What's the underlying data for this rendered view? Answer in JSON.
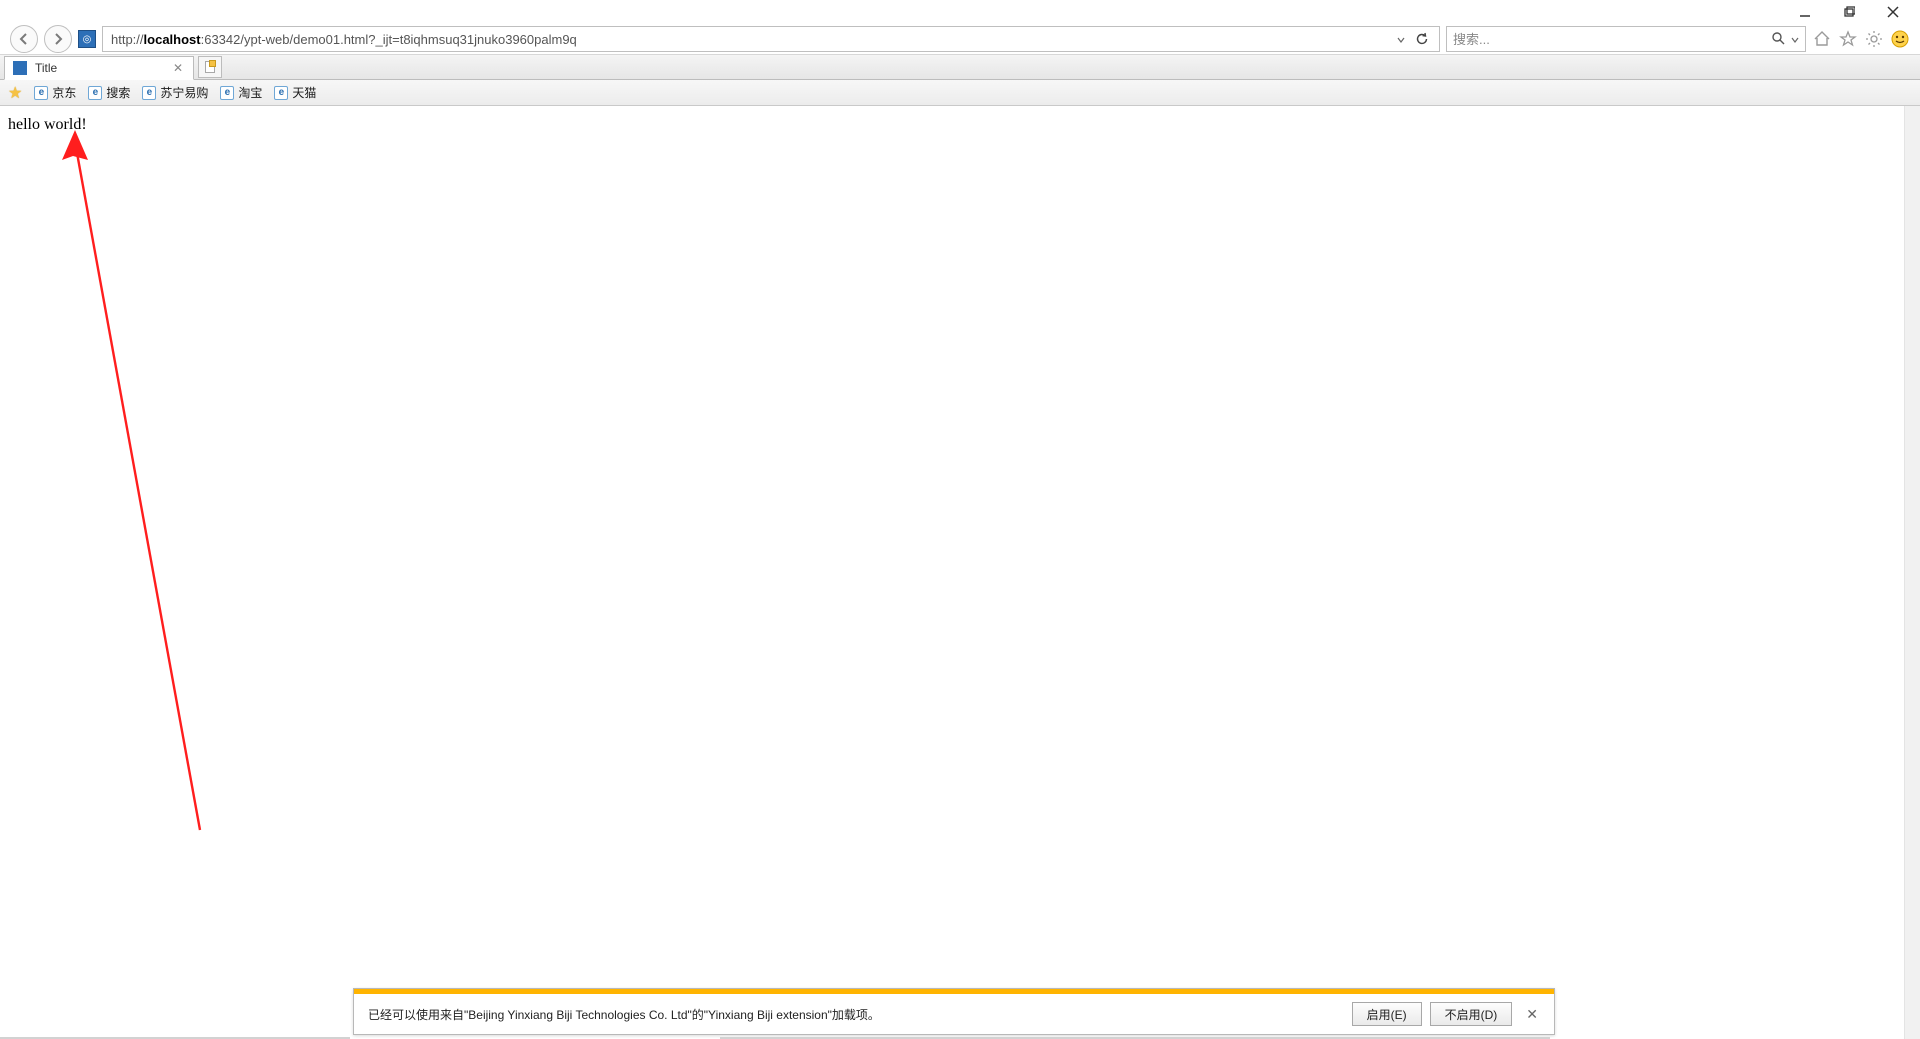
{
  "window": {
    "minimize_title": "Minimize",
    "maximize_title": "Restore",
    "close_title": "Close"
  },
  "toolbar": {
    "url_prefix": "http://",
    "url_host": "localhost",
    "url_rest": ":63342/ypt-web/demo01.html?_ijt=t8iqhmsuq31jnuko3960palm9q",
    "search_placeholder": "搜索..."
  },
  "tab": {
    "title": "Title"
  },
  "bookmarks": {
    "items": [
      {
        "label": "京东"
      },
      {
        "label": "搜索"
      },
      {
        "label": "苏宁易购"
      },
      {
        "label": "淘宝"
      },
      {
        "label": "天猫"
      }
    ]
  },
  "page": {
    "body_text": "hello world!"
  },
  "notification": {
    "message": "已经可以使用来自\"Beijing Yinxiang Biji Technologies Co. Ltd\"的\"Yinxiang Biji extension\"加载项。",
    "enable_label": "启用(E)",
    "disable_label": "不启用(D)"
  }
}
